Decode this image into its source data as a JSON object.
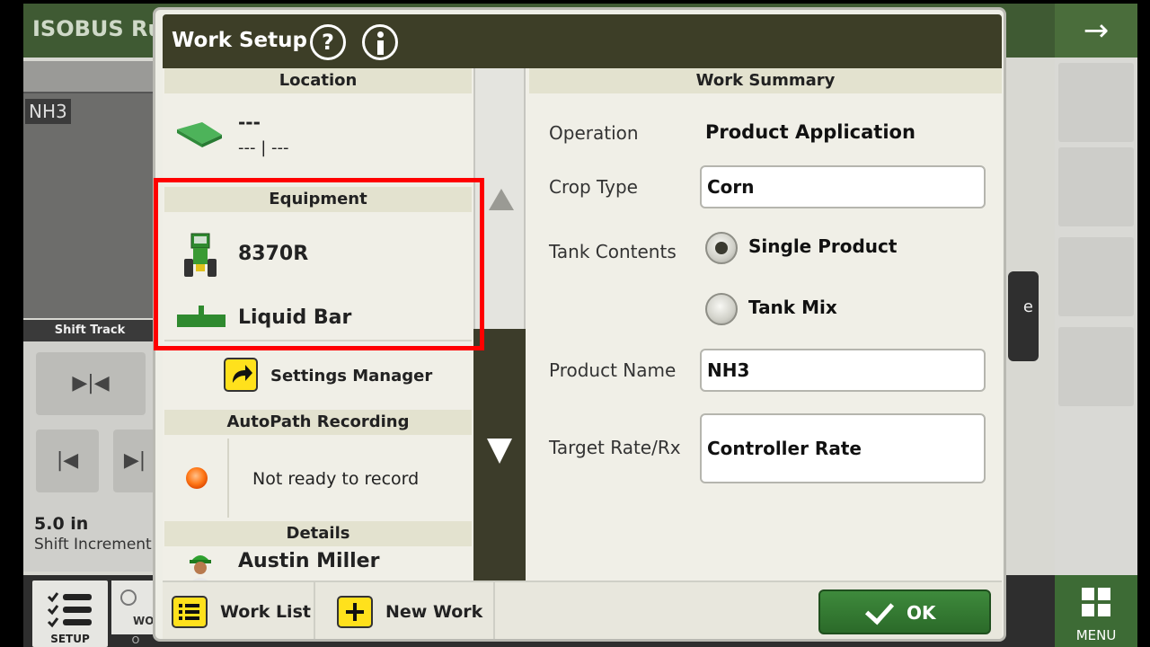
{
  "background": {
    "app_title": "ISOBUS Ru",
    "map_label": "NH3",
    "shift_track_label": "Shift Track",
    "shift_increment_value": "5.0 in",
    "shift_increment_label": "Shift Increment",
    "setup_label": "SETUP",
    "menu_label": "MENU",
    "partial_wo": "WO",
    "partial_o": "O"
  },
  "dialog": {
    "title": "Work Setup",
    "help_icon_glyph": "?",
    "location": {
      "header": "Location",
      "line1": "---",
      "line2": "--- | ---"
    },
    "equipment": {
      "header": "Equipment",
      "tractor": "8370R",
      "implement": "Liquid Bar"
    },
    "settings_manager_label": "Settings Manager",
    "autopath": {
      "header": "AutoPath Recording",
      "status": "Not ready to record"
    },
    "details": {
      "header": "Details",
      "operator": "Austin Miller"
    },
    "work_summary": {
      "header": "Work Summary",
      "operation_label": "Operation",
      "operation_value": "Product Application",
      "crop_type_label": "Crop Type",
      "crop_type_value": "Corn",
      "tank_contents_label": "Tank Contents",
      "tank_options": [
        "Single Product",
        "Tank Mix"
      ],
      "tank_selected": "Single Product",
      "product_name_label": "Product Name",
      "product_name_value": "NH3",
      "target_rate_label": "Target Rate/Rx",
      "target_rate_value": "Controller Rate"
    },
    "footer": {
      "work_list_label": "Work List",
      "new_work_label": "New Work",
      "ok_label": "OK"
    }
  },
  "colors": {
    "titlebar": "#3d3e27",
    "section_header": "#e3e2cf",
    "ok_green": "#2b6a29",
    "highlight_red": "#ff0000",
    "softkey_yellow": "#ffe11c",
    "jd_green": "#3a8f2c"
  }
}
